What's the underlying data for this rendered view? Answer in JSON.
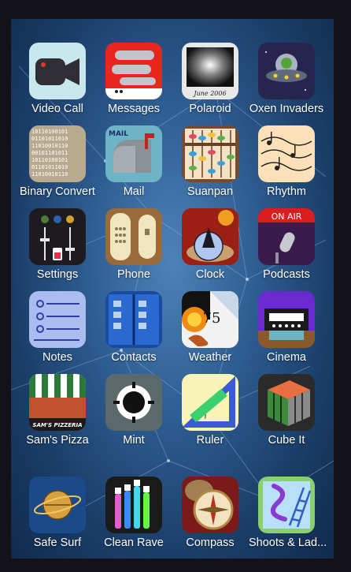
{
  "apps": [
    {
      "name": "video-call",
      "label": "Video Call",
      "icon": "video-camera-icon"
    },
    {
      "name": "messages",
      "label": "Messages",
      "icon": "chat-bubbles-icon"
    },
    {
      "name": "polaroid",
      "label": "Polaroid",
      "icon": "polaroid-photo-icon",
      "caption": "June 2006"
    },
    {
      "name": "oxen-invaders",
      "label": "Oxen Invaders",
      "icon": "ufo-icon"
    },
    {
      "name": "binary-convert",
      "label": "Binary Convert",
      "icon": "binary-digits-icon"
    },
    {
      "name": "mail",
      "label": "Mail",
      "icon": "mailbox-icon",
      "sign": "MAIL"
    },
    {
      "name": "suanpan",
      "label": "Suanpan",
      "icon": "abacus-icon"
    },
    {
      "name": "rhythm",
      "label": "Rhythm",
      "icon": "music-notes-icon"
    },
    {
      "name": "settings",
      "label": "Settings",
      "icon": "sliders-icon"
    },
    {
      "name": "phone",
      "label": "Phone",
      "icon": "phone-handset-icon"
    },
    {
      "name": "clock",
      "label": "Clock",
      "icon": "sundial-clock-icon"
    },
    {
      "name": "podcasts",
      "label": "Podcasts",
      "icon": "microphone-icon",
      "sign": "ON AIR"
    },
    {
      "name": "notes",
      "label": "Notes",
      "icon": "notes-list-icon"
    },
    {
      "name": "contacts",
      "label": "Contacts",
      "icon": "address-book-icon"
    },
    {
      "name": "weather",
      "label": "Weather",
      "icon": "weather-icon",
      "temperature": "75"
    },
    {
      "name": "cinema",
      "label": "Cinema",
      "icon": "film-projector-icon"
    },
    {
      "name": "sams-pizza",
      "label": "Sam's Pizza",
      "icon": "pizzeria-storefront-icon",
      "sign": "SAM'S PIZZERIA"
    },
    {
      "name": "mint",
      "label": "Mint",
      "icon": "mint-candy-icon"
    },
    {
      "name": "ruler",
      "label": "Ruler",
      "icon": "ruler-triangle-icon"
    },
    {
      "name": "cube-it",
      "label": "Cube It",
      "icon": "rubiks-cube-icon"
    },
    {
      "name": "safe-surf",
      "label": "Safe Surf",
      "icon": "planet-compass-icon"
    },
    {
      "name": "clean-rave",
      "label": "Clean Rave",
      "icon": "neon-toothbrushes-icon"
    },
    {
      "name": "compass",
      "label": "Compass",
      "icon": "compass-icon"
    },
    {
      "name": "shoots-ladders",
      "label": "Shoots & Lad...",
      "icon": "snake-ladder-icon"
    }
  ],
  "colors": {
    "screen_top": "#4d82b8",
    "screen_edge": "#102a4d",
    "frame": "#121218",
    "label": "#ffffff"
  }
}
